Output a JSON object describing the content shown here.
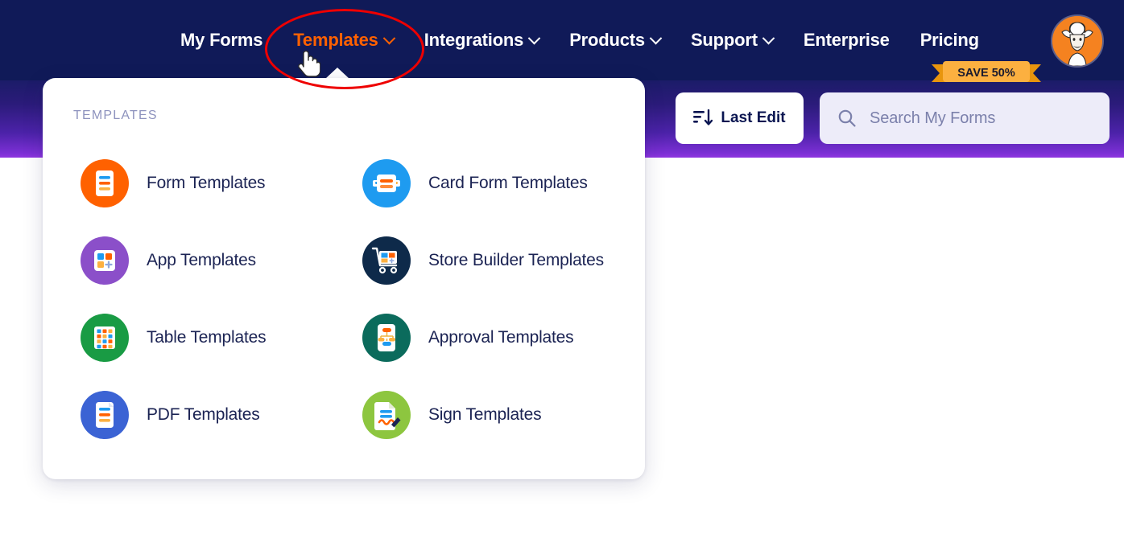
{
  "nav": {
    "items": [
      {
        "label": "My Forms",
        "has_caret": false,
        "active": false,
        "name": "nav-my-forms"
      },
      {
        "label": "Templates",
        "has_caret": true,
        "active": true,
        "name": "nav-templates"
      },
      {
        "label": "Integrations",
        "has_caret": true,
        "active": false,
        "name": "nav-integrations"
      },
      {
        "label": "Products",
        "has_caret": true,
        "active": false,
        "name": "nav-products"
      },
      {
        "label": "Support",
        "has_caret": true,
        "active": false,
        "name": "nav-support"
      },
      {
        "label": "Enterprise",
        "has_caret": false,
        "active": false,
        "name": "nav-enterprise"
      },
      {
        "label": "Pricing",
        "has_caret": false,
        "active": false,
        "name": "nav-pricing"
      }
    ],
    "promo_badge": "SAVE 50%",
    "avatar_alt": "user-avatar"
  },
  "toolbar": {
    "sort_label": "Last Edit",
    "sort_icon": "sort-descending-icon",
    "search_placeholder": "Search My Forms",
    "search_value": "",
    "search_icon": "search-icon"
  },
  "dropdown": {
    "heading": "TEMPLATES",
    "items": [
      {
        "label": "Form Templates",
        "icon": "form-templates-icon",
        "color": "#FF6100",
        "name": "menu-item-form-templates"
      },
      {
        "label": "Card Form Templates",
        "icon": "card-form-templates-icon",
        "color": "#1E9BF0",
        "name": "menu-item-card-form-templates"
      },
      {
        "label": "App Templates",
        "icon": "app-templates-icon",
        "color": "#8B4FC9",
        "name": "menu-item-app-templates"
      },
      {
        "label": "Store Builder Templates",
        "icon": "store-builder-templates-icon",
        "color": "#0E2A4A",
        "name": "menu-item-store-builder-templates"
      },
      {
        "label": "Table Templates",
        "icon": "table-templates-icon",
        "color": "#199B44",
        "name": "menu-item-table-templates"
      },
      {
        "label": "Approval Templates",
        "icon": "approval-templates-icon",
        "color": "#0B6B5C",
        "name": "menu-item-approval-templates"
      },
      {
        "label": "PDF Templates",
        "icon": "pdf-templates-icon",
        "color": "#3B63D4",
        "name": "menu-item-pdf-templates"
      },
      {
        "label": "Sign Templates",
        "icon": "sign-templates-icon",
        "color": "#8DC63F",
        "name": "menu-item-sign-templates"
      }
    ]
  },
  "annotation": {
    "highlight_target": "Templates",
    "cursor": "pointing-hand-cursor"
  },
  "colors": {
    "nav_bg": "#101A58",
    "accent_orange": "#FF6100",
    "highlight_red": "#EE0000",
    "gradient_purple": "#8F35E0",
    "search_bg": "#EDECF9",
    "text_dark": "#1B2353"
  }
}
